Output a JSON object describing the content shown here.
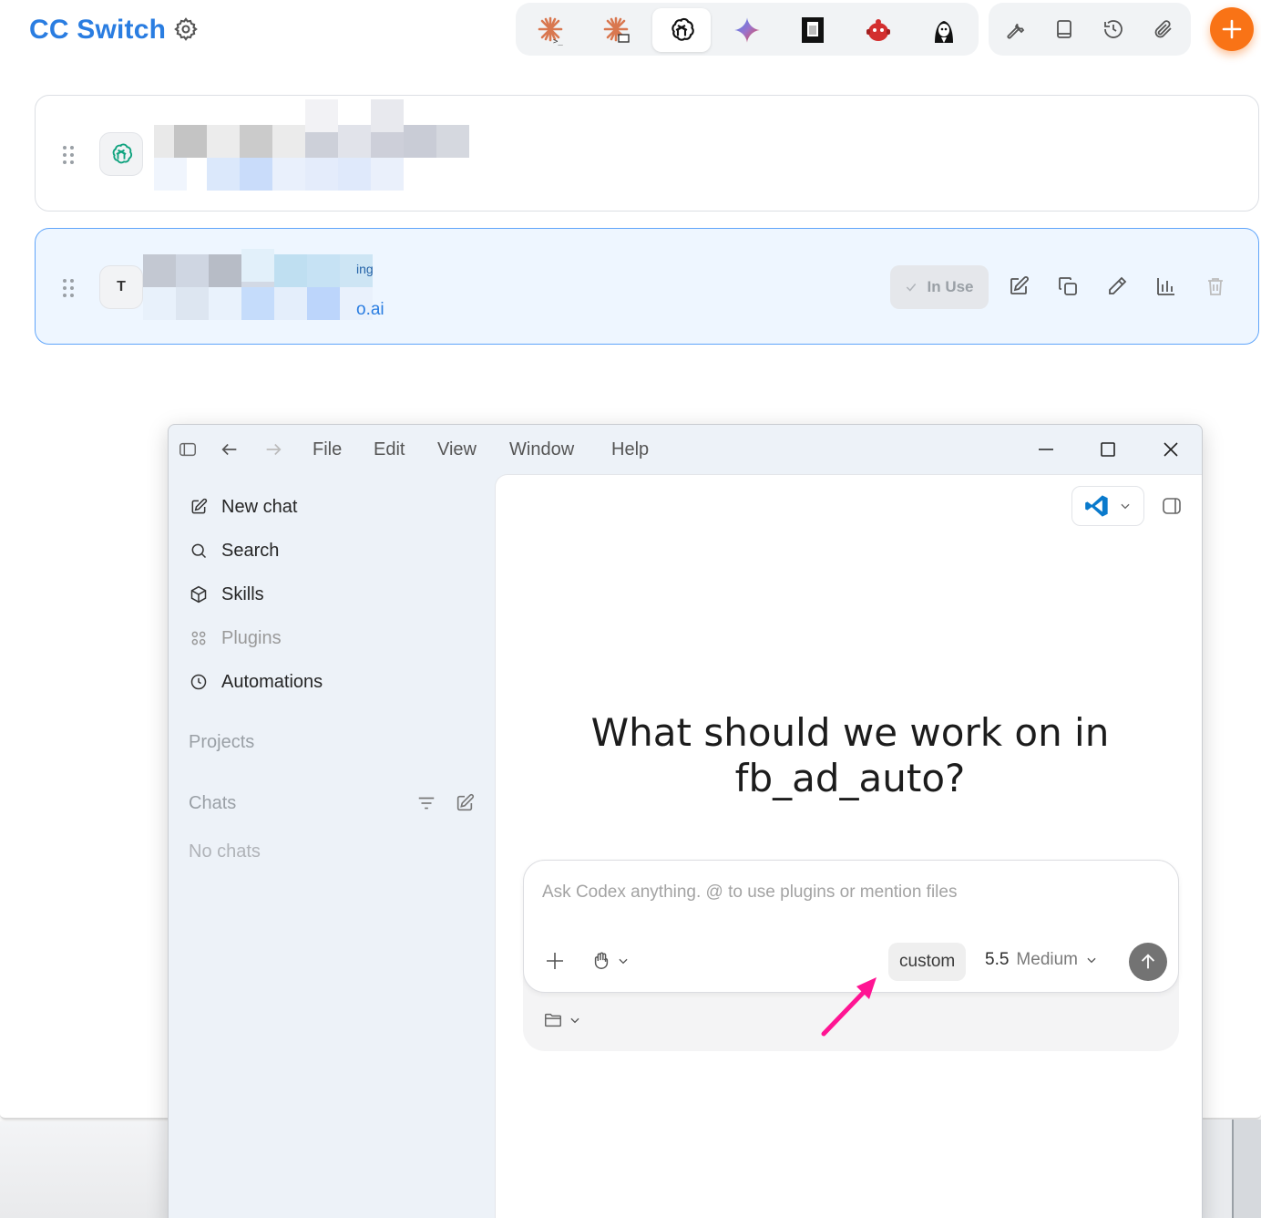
{
  "cc_switch": {
    "title": "CC Switch",
    "accent": "#2a7de1",
    "apps": [
      {
        "name": "claude-code-icon",
        "active": false
      },
      {
        "name": "claude-desktop-icon",
        "active": false
      },
      {
        "name": "codex-openai-icon",
        "active": true
      },
      {
        "name": "gemini-icon",
        "active": false
      },
      {
        "name": "opencode-icon",
        "active": false
      },
      {
        "name": "bot-icon",
        "active": false
      },
      {
        "name": "character-icon",
        "active": false
      }
    ],
    "tools": [
      "wrench-icon",
      "book-icon",
      "history-icon",
      "paperclip-icon"
    ],
    "add_color": "#f97316",
    "providers": [
      {
        "avatar": "openai-icon",
        "name_fragment": "",
        "url_fragment": "",
        "in_use": false
      },
      {
        "avatar": "T",
        "name_fragment": "ing",
        "url_fragment": "o.ai",
        "in_use": true,
        "in_use_label": "In Use"
      }
    ]
  },
  "codex": {
    "menu": [
      "File",
      "Edit",
      "View",
      "Window",
      "Help"
    ],
    "sidebar": {
      "items": [
        {
          "label": "New chat",
          "icon": "new-chat-icon"
        },
        {
          "label": "Search",
          "icon": "search-icon"
        },
        {
          "label": "Skills",
          "icon": "skills-icon"
        },
        {
          "label": "Plugins",
          "icon": "plugins-icon"
        },
        {
          "label": "Automations",
          "icon": "clock-icon"
        }
      ],
      "projects_label": "Projects",
      "chats_label": "Chats",
      "no_chats": "No chats"
    },
    "headline_line1": "What should we work on in",
    "headline_line2": "fb_ad_auto?",
    "composer": {
      "placeholder": "Ask Codex anything. @ to use plugins or mention files",
      "custom_label": "custom",
      "model_version": "5.5",
      "model_effort": "Medium"
    },
    "annotation_color": "#ff1493"
  }
}
